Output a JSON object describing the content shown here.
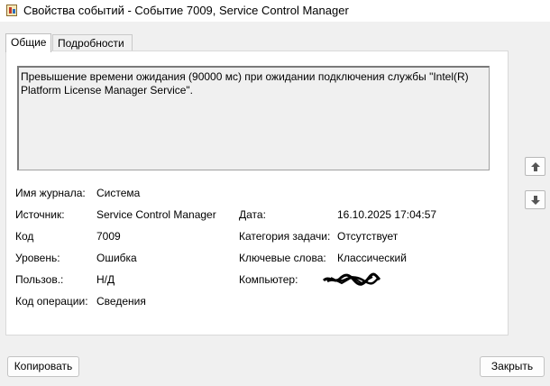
{
  "window": {
    "title": "Свойства событий - Событие 7009, Service Control Manager"
  },
  "tabs": [
    {
      "label": "Общие",
      "active": true
    },
    {
      "label": "Подробности",
      "active": false
    }
  ],
  "description": "Превышение времени ожидания (90000 мс) при ожидании подключения службы \"Intel(R) Platform License Manager Service\".",
  "fields": {
    "log_name": {
      "label": "Имя журнала:",
      "value": "Система"
    },
    "source": {
      "label": "Источник:",
      "value": "Service Control Manager"
    },
    "date": {
      "label": "Дата:",
      "value": "16.10.2025 17:04:57"
    },
    "event_id": {
      "label": "Код",
      "value": "7009"
    },
    "task_category": {
      "label": "Категория задачи:",
      "value": "Отсутствует"
    },
    "level": {
      "label": "Уровень:",
      "value": "Ошибка"
    },
    "keywords": {
      "label": "Ключевые слова:",
      "value": "Классический"
    },
    "user": {
      "label": "Пользов.:",
      "value": "Н/Д"
    },
    "computer": {
      "label": "Компьютер:"
    },
    "opcode": {
      "label": "Код операции:",
      "value": "Сведения"
    }
  },
  "buttons": {
    "copy": "Копировать",
    "close": "Закрыть"
  },
  "icons": {
    "scroll_up": "arrow-up-icon",
    "scroll_down": "arrow-down-icon",
    "app": "event-viewer-icon"
  }
}
